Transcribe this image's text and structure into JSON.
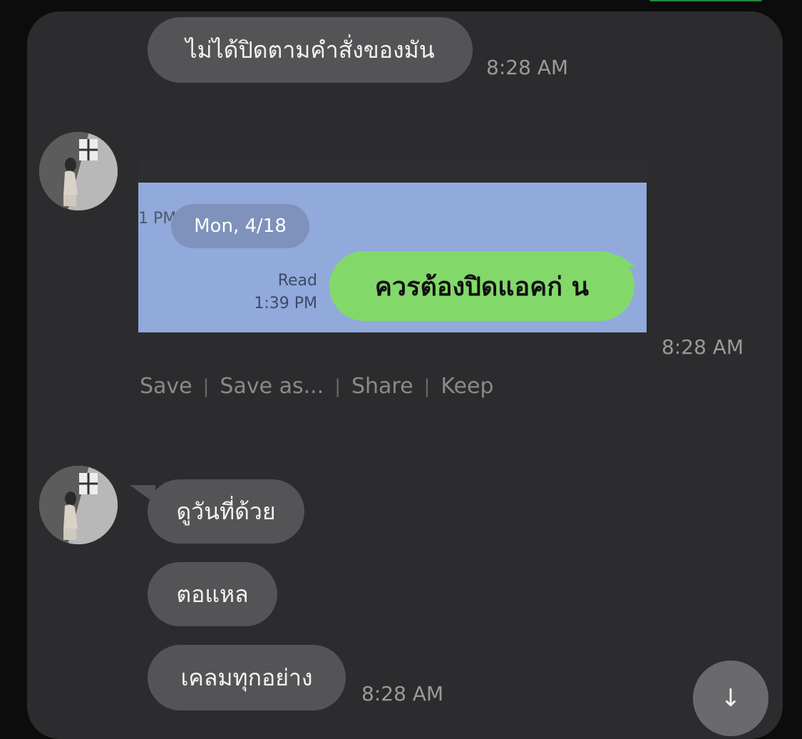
{
  "messages": {
    "m1": {
      "text": "ไม่ได้ปิดตามคำสั่งของมัน",
      "time": "8:28 AM"
    },
    "image_message": {
      "time": "8:28 AM",
      "embedded": {
        "cut_time": "1 PM",
        "date_pill": "Mon, 4/18",
        "read_label": "Read",
        "read_time": "1:39 PM",
        "bubble_text": "ควรต้องปิดแอคก่ น"
      },
      "actions": {
        "save": "Save",
        "save_as": "Save as...",
        "share": "Share",
        "keep": "Keep"
      }
    },
    "m3": {
      "text": "ดูวันที่ด้วย"
    },
    "m4": {
      "text": "ตอแหล"
    },
    "m5": {
      "text": "เคลมทุกอย่าง",
      "time": "8:28 AM"
    }
  },
  "scroll_button": {
    "icon": "arrow-down-icon",
    "glyph": "↓"
  },
  "colors": {
    "panel": "#2c2c2e",
    "bubble": "#545456",
    "line_green": "#82d96a",
    "shot_bg": "#92a9dc"
  }
}
